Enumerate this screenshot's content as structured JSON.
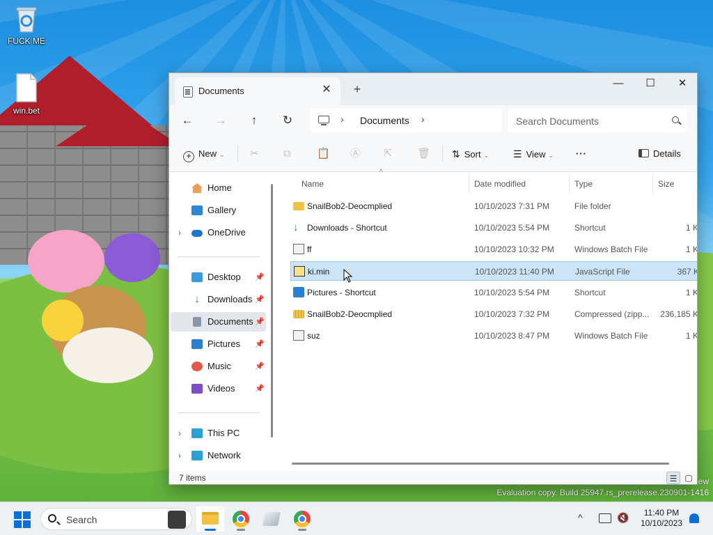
{
  "desktop": {
    "icons": [
      {
        "label": "FUCK ME",
        "icon": "recycle-bin-icon"
      },
      {
        "label": "win.bet",
        "icon": "file-icon"
      }
    ],
    "watermark": {
      "line1": "ew",
      "line2": "Evaluation copy. Build 25947.rs_prerelease.230901-1416"
    }
  },
  "window": {
    "tab": {
      "title": "Documents",
      "close": "✕"
    },
    "new_tab": "+",
    "controls": {
      "minimize": "—",
      "maximize": "☐",
      "close": "✕"
    },
    "nav": {
      "back": "←",
      "forward": "→",
      "up": "↑",
      "refresh": "↻"
    },
    "address": {
      "crumb": "Documents",
      "chev1": "›",
      "chev2": "›"
    },
    "search": {
      "placeholder": "Search Documents"
    },
    "commandbar": {
      "new_label": "New",
      "sort_label": "Sort",
      "view_label": "View",
      "more_label": "···",
      "details_label": "Details",
      "caret": "⌄"
    },
    "sidebar": {
      "items": [
        {
          "label": "Home",
          "icon": "home-icon"
        },
        {
          "label": "Gallery",
          "icon": "gallery-icon"
        },
        {
          "label": "OneDrive",
          "icon": "onedrive-icon"
        },
        {
          "label": "Desktop",
          "icon": "desktop-icon",
          "pinned": true
        },
        {
          "label": "Downloads",
          "icon": "download-icon",
          "pinned": true
        },
        {
          "label": "Documents",
          "icon": "documents-icon",
          "pinned": true,
          "selected": true
        },
        {
          "label": "Pictures",
          "icon": "pictures-icon",
          "pinned": true
        },
        {
          "label": "Music",
          "icon": "music-icon",
          "pinned": true
        },
        {
          "label": "Videos",
          "icon": "videos-icon",
          "pinned": true
        },
        {
          "label": "This PC",
          "icon": "this-pc-icon"
        },
        {
          "label": "Network",
          "icon": "network-icon"
        }
      ],
      "expand": "›",
      "pin": "📌"
    },
    "filelist": {
      "columns": {
        "name": "Name",
        "date": "Date modified",
        "type": "Type",
        "size": "Size"
      },
      "sort_indicator": "^",
      "rows": [
        {
          "name": "SnailBob2-Deocmplied",
          "date": "10/10/2023 7:31 PM",
          "type": "File folder",
          "size": "",
          "icon": "folder-icon"
        },
        {
          "name": "Downloads - Shortcut",
          "date": "10/10/2023 5:54 PM",
          "type": "Shortcut",
          "size": "1 K",
          "icon": "shortcut-icon"
        },
        {
          "name": "ff",
          "date": "10/10/2023 10:32 PM",
          "type": "Windows Batch File",
          "size": "1 K",
          "icon": "batch-file-icon"
        },
        {
          "name": "ki.min",
          "date": "10/10/2023 11:40 PM",
          "type": "JavaScript File",
          "size": "367 K",
          "icon": "javascript-file-icon",
          "selected": true
        },
        {
          "name": "Pictures - Shortcut",
          "date": "10/10/2023 5:54 PM",
          "type": "Shortcut",
          "size": "1 K",
          "icon": "pictures-shortcut-icon"
        },
        {
          "name": "SnailBob2-Deocmplied",
          "date": "10/10/2023 7:32 PM",
          "type": "Compressed (zipp...",
          "size": "236,185 K",
          "icon": "zip-folder-icon"
        },
        {
          "name": "suz",
          "date": "10/10/2023 8:47 PM",
          "type": "Windows Batch File",
          "size": "1 K",
          "icon": "batch-file-icon"
        }
      ]
    },
    "status": {
      "count": "7 items"
    }
  },
  "taskbar": {
    "search_label": "Search",
    "apps": [
      "file-explorer",
      "chrome",
      "paint-3d",
      "chrome"
    ],
    "tray": {
      "chevron": "^",
      "time": "11:40 PM",
      "date": "10/10/2023"
    }
  }
}
